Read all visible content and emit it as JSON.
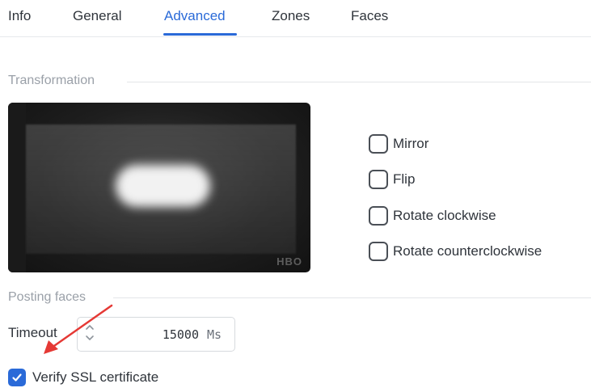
{
  "tabs": [
    {
      "label": "Info"
    },
    {
      "label": "General"
    },
    {
      "label": "Advanced",
      "active": true
    },
    {
      "label": "Zones"
    },
    {
      "label": "Faces"
    }
  ],
  "transformation": {
    "title": "Transformation",
    "preview_watermark": "HBO",
    "options": [
      {
        "label": "Mirror",
        "checked": false
      },
      {
        "label": "Flip",
        "checked": false
      },
      {
        "label": "Rotate clockwise",
        "checked": false
      },
      {
        "label": "Rotate counterclockwise",
        "checked": false
      }
    ]
  },
  "posting_faces": {
    "title": "Posting faces",
    "timeout_label": "Timeout",
    "timeout_value": "15000",
    "timeout_unit": "Ms",
    "verify_ssl_label": "Verify SSL certificate",
    "verify_ssl_checked": true
  },
  "colors": {
    "accent": "#2a6ad8",
    "annotation_arrow": "#e53935"
  }
}
